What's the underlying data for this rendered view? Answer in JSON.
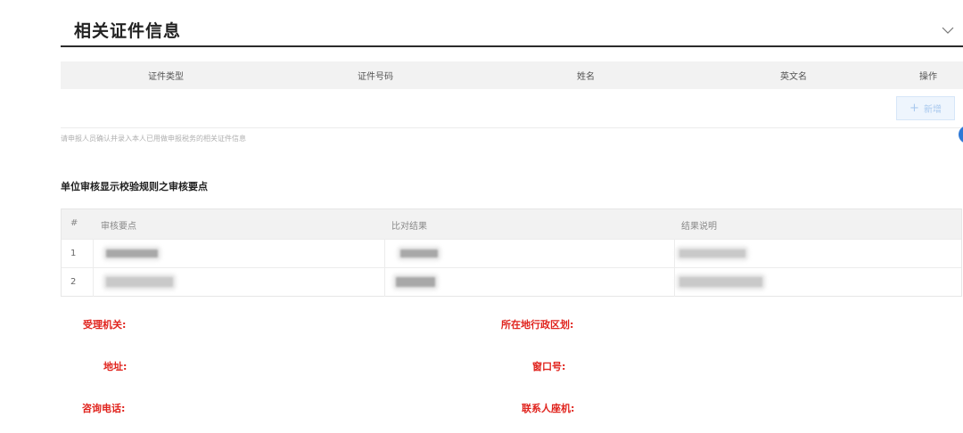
{
  "section": {
    "title": "相关证件信息"
  },
  "cert_table": {
    "headers": [
      "证件类型",
      "证件号码",
      "姓名",
      "英文名",
      "操作"
    ],
    "add_button": "新增",
    "add_icon": "plus-icon",
    "hint": "请申报人员确认并录入本人已用做申报税务的相关证件信息"
  },
  "audit": {
    "title": "单位审核显示校验规则之审核要点",
    "headers": [
      "#",
      "审核要点",
      "比对结果",
      "结果说明"
    ],
    "rows": [
      {
        "index": "1"
      },
      {
        "index": "2"
      }
    ]
  },
  "office_info": {
    "agency": "受理机关:",
    "region": "所在地行政区划:",
    "address": "地址:",
    "window": "窗口号:",
    "phone": "咨询电话:",
    "contact": "联系人座机:"
  },
  "colors": {
    "accent_red": "#e0231d",
    "primary_blue": "#2f79d6",
    "title_dark": "#222222"
  }
}
